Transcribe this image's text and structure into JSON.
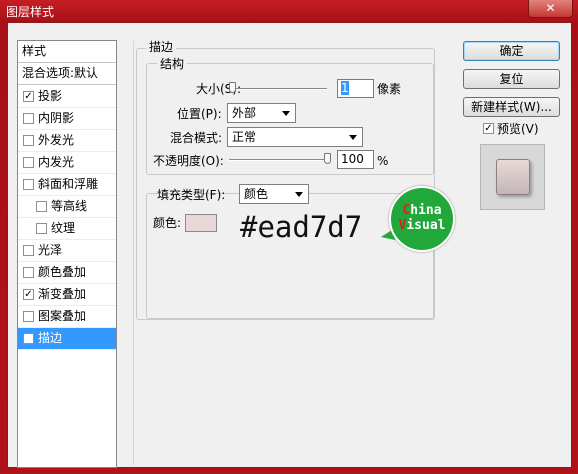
{
  "window": {
    "title": "图层样式",
    "close_glyph": "✕"
  },
  "sidebar": {
    "header": "样式",
    "blend_defaults": "混合选项:默认",
    "items": [
      {
        "label": "投影",
        "checked": true
      },
      {
        "label": "内阴影",
        "checked": false
      },
      {
        "label": "外发光",
        "checked": false
      },
      {
        "label": "内发光",
        "checked": false
      },
      {
        "label": "斜面和浮雕",
        "checked": false
      },
      {
        "label": "等高线",
        "checked": false
      },
      {
        "label": "纹理",
        "checked": false
      },
      {
        "label": "光泽",
        "checked": false
      },
      {
        "label": "颜色叠加",
        "checked": false
      },
      {
        "label": "渐变叠加",
        "checked": true
      },
      {
        "label": "图案叠加",
        "checked": false
      },
      {
        "label": "描边",
        "checked": true,
        "selected": true
      }
    ],
    "check_glyph": "✓"
  },
  "stroke": {
    "section_title": "描边",
    "structure_title": "结构",
    "size_label": "大小(S):",
    "size_value": "1",
    "size_unit": "像素",
    "size_slider": 1,
    "position_label": "位置(P):",
    "position_value": "外部",
    "blend_label": "混合模式:",
    "blend_value": "正常",
    "opacity_label": "不透明度(O):",
    "opacity_value": "100",
    "opacity_unit": "%",
    "opacity_slider": 100
  },
  "fill": {
    "type_label": "填充类型(F):",
    "type_value": "颜色",
    "color_label": "颜色:",
    "color_hex": "#ead7d7",
    "swatch_color": "#ead7d7"
  },
  "watermark": {
    "line1": "China",
    "line2": "Visual"
  },
  "buttons": {
    "ok": "确定",
    "reset": "复位",
    "new_style": "新建样式(W)...",
    "preview_label": "预览(V)",
    "preview_checked": true
  },
  "colors": {
    "selection": "#3399ff",
    "title_bar": "#b8141c",
    "badge": "#22a83a"
  }
}
